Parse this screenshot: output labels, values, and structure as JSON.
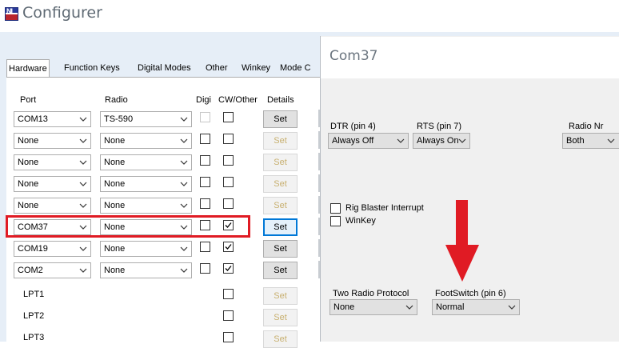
{
  "app": {
    "title": "Configurer",
    "icon_text": "NI"
  },
  "tabs": [
    "Hardware",
    "Function Keys",
    "Digital Modes",
    "Other",
    "Winkey",
    "Mode C"
  ],
  "columns": {
    "port": "Port",
    "radio": "Radio",
    "digi": "Digi",
    "cw": "CW/Other",
    "details": "Details"
  },
  "rows": [
    {
      "port": "COM13",
      "radio": "TS-590",
      "digi": false,
      "digi_enabled": false,
      "cw": false,
      "set": "Set",
      "set_enabled": true
    },
    {
      "port": "None",
      "radio": "None",
      "digi": false,
      "digi_enabled": true,
      "cw": false,
      "set": "Set",
      "set_enabled": false
    },
    {
      "port": "None",
      "radio": "None",
      "digi": false,
      "digi_enabled": true,
      "cw": false,
      "set": "Set",
      "set_enabled": false
    },
    {
      "port": "None",
      "radio": "None",
      "digi": false,
      "digi_enabled": true,
      "cw": false,
      "set": "Set",
      "set_enabled": false
    },
    {
      "port": "None",
      "radio": "None",
      "digi": false,
      "digi_enabled": true,
      "cw": false,
      "set": "Set",
      "set_enabled": false
    },
    {
      "port": "COM37",
      "radio": "None",
      "digi": false,
      "digi_enabled": true,
      "cw": true,
      "set": "Set",
      "set_enabled": true,
      "focused": true,
      "highlighted": true
    },
    {
      "port": "COM19",
      "radio": "None",
      "digi": false,
      "digi_enabled": true,
      "cw": true,
      "set": "Set",
      "set_enabled": true
    },
    {
      "port": "COM2",
      "radio": "None",
      "digi": false,
      "digi_enabled": true,
      "cw": true,
      "set": "Set",
      "set_enabled": true
    }
  ],
  "lpt_rows": [
    {
      "port": "LPT1",
      "cw": false,
      "set": "Set"
    },
    {
      "port": "LPT2",
      "cw": false,
      "set": "Set"
    },
    {
      "port": "LPT3",
      "cw": false,
      "set": "Set"
    }
  ],
  "dialog": {
    "title": "Com37",
    "dtr_label": "DTR (pin 4)",
    "dtr_value": "Always Off",
    "rts_label": "RTS (pin 7)",
    "rts_value": "Always On",
    "radio_nr_label": "Radio Nr",
    "radio_nr_value": "Both",
    "rig_blaster_label": "Rig Blaster Interrupt",
    "rig_blaster_checked": false,
    "winkey_label": "WinKey",
    "winkey_checked": false,
    "two_radio_label": "Two Radio Protocol",
    "two_radio_value": "None",
    "footswitch_label": "FootSwitch (pin 6)",
    "footswitch_value": "Normal"
  },
  "colors": {
    "highlight": "#e01b24",
    "arrow": "#e01b24",
    "focus": "#0078d7"
  }
}
